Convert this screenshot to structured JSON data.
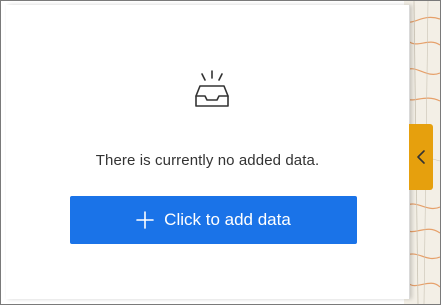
{
  "panel": {
    "empty_message": "There is currently no added data.",
    "add_button_label": "Click to add data",
    "empty_icon": "empty-inbox-icon"
  },
  "collapse_tab": {
    "icon": "chevron-left-icon"
  },
  "colors": {
    "button_background": "#1a73e8",
    "button_text": "#ffffff",
    "collapse_tab": "#e6a00d",
    "map_background": "#f3efe6",
    "map_contour": "#e6a06a"
  }
}
